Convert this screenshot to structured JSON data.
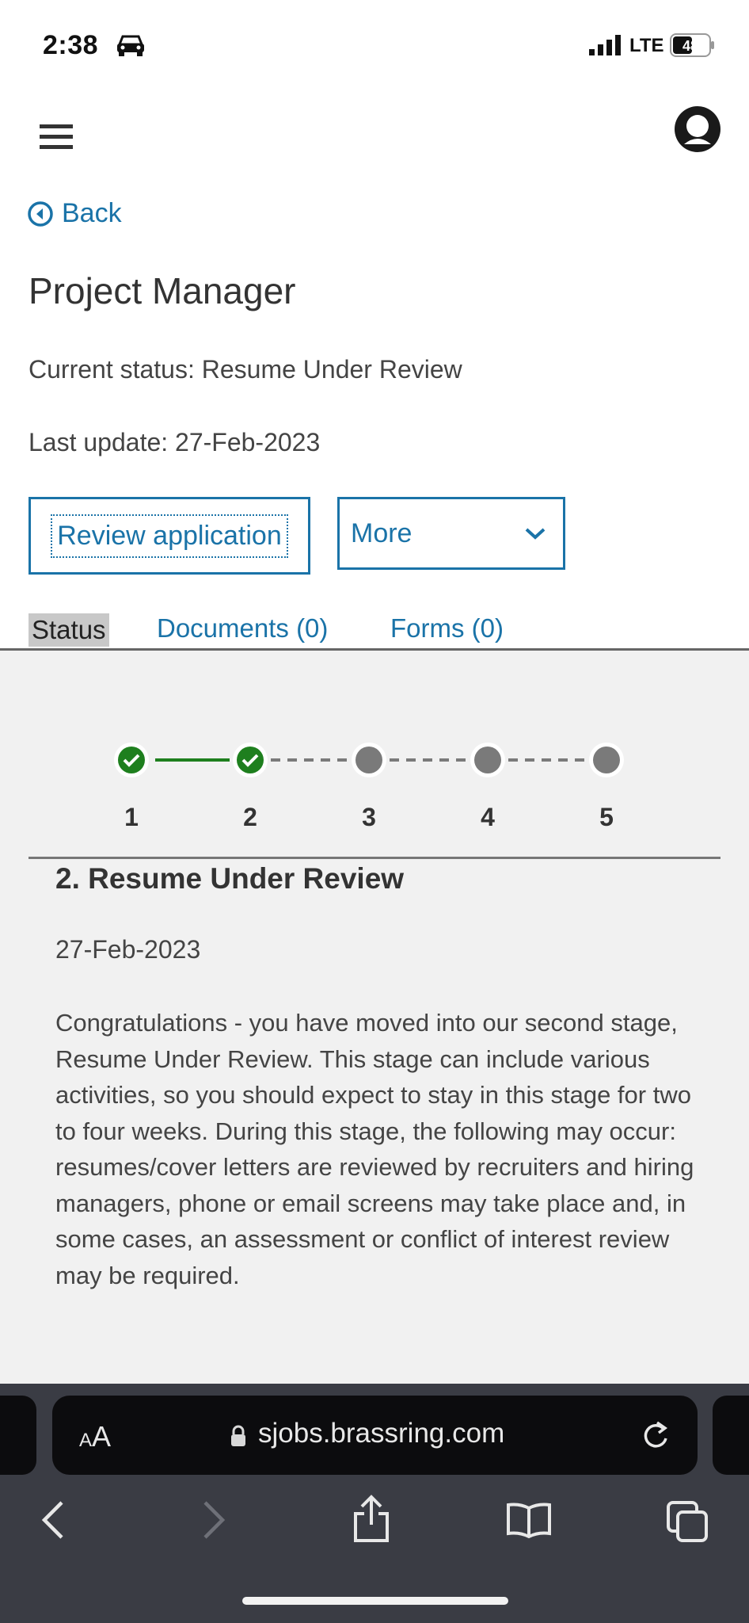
{
  "status_bar": {
    "time": "2:38",
    "network": "LTE",
    "battery": "48"
  },
  "header": {
    "back_label": "Back",
    "title": "Project Manager",
    "current_status": "Current status: Resume Under Review",
    "last_update": "Last update: 27-Feb-2023"
  },
  "actions": {
    "review_label": "Review application",
    "more_label": "More"
  },
  "tabs": [
    {
      "label": "Status",
      "active": true
    },
    {
      "label": "Documents (0)"
    },
    {
      "label": "Forms (0)"
    }
  ],
  "stepper": {
    "steps": [
      "1",
      "2",
      "3",
      "4",
      "5"
    ],
    "completed": 2,
    "complete_color": "#1e7f1e",
    "pending_color": "#7a7a7a"
  },
  "stage": {
    "title": "2. Resume Under Review",
    "date": "27-Feb-2023",
    "description": "Congratulations - you have moved into our second stage, Resume Under Review. This stage can include various activities, so you should expect to stay in this stage for two to four weeks. During this stage, the following may occur: resumes/cover letters are reviewed by recruiters and hiring managers, phone or email screens may take place and, in some cases, an assessment or conflict of interest review may be required."
  },
  "browser": {
    "aa_small": "A",
    "aa_large": "A",
    "url": "sjobs.brassring.com"
  },
  "colors": {
    "link": "#1a73a8",
    "content_bg": "#f1f1f1",
    "browser_bg": "#3a3c44"
  }
}
